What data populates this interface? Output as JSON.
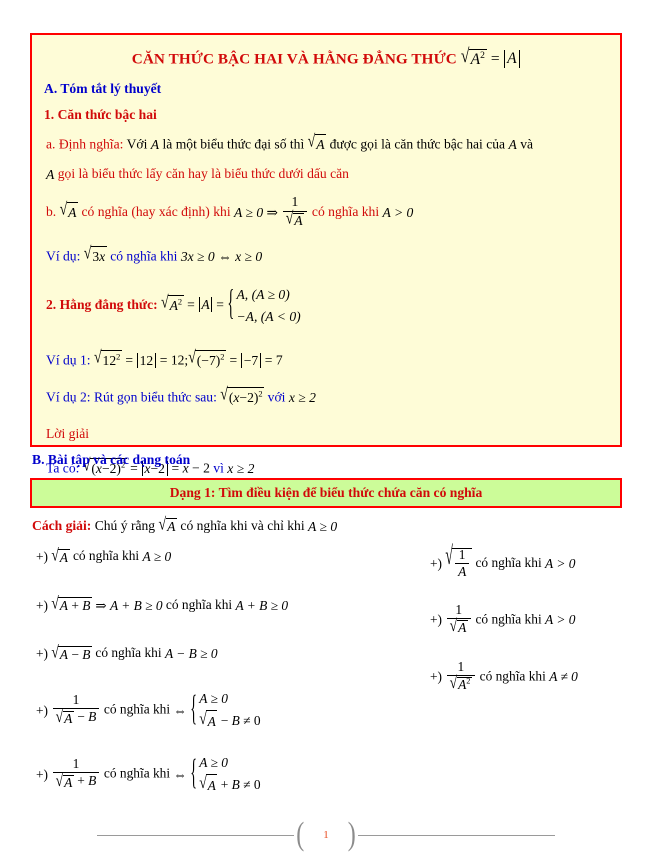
{
  "document": {
    "title_text": "CĂN THỨC BẬC HAI VÀ HẰNG ĐẲNG THỨC",
    "section_a": "A. Tóm tắt lý thuyết",
    "sub_1": "1. Căn thức bậc hai",
    "def_a_label": "a. Định nghĩa:",
    "def_a_text_1": "Với",
    "def_a_text_2": "là một biểu thức đại số thì",
    "def_a_text_3": "được gọi là căn thức bậc hai của",
    "def_a_text_4": "và",
    "def_a_text_5": "gọi là biểu thức lấy căn hay là biểu thức dưới dấu căn",
    "def_b_label": "b.",
    "def_b_text_1": "có nghĩa (hay xác định) khi",
    "def_b_text_2": "có nghĩa khi",
    "example_label": "Ví dụ:",
    "example_text": "có nghĩa khi",
    "sub_2": "2. Hằng đẳng thức:",
    "vd1_label": "Ví dụ 1:",
    "vd2_label": "Ví dụ 2:",
    "vd2_text": "Rút gọn biểu thức sau:",
    "vd2_with": "với",
    "loi_giai": "Lời giải",
    "ta_co": "Ta có:",
    "vi": "vì",
    "section_b": "B. Bài tập và các dạng toán",
    "dang_1": "Dạng 1: Tìm điều kiện để biểu thức chứa căn có nghĩa",
    "cach_giai_label": "Cách giải:",
    "cach_giai_text_1": "Chú ý rằng",
    "cach_giai_text_2": "có nghĩa khi và chỉ khi"
  },
  "math": {
    "A": "A",
    "B": "B",
    "sqrt_A_sq_eq_abs_A": "√A² = |A|",
    "A_ge_0": "A ≥ 0",
    "A_gt_0": "A > 0",
    "A_lt_0": "A < 0",
    "A_ne_0": "A ≠ 0",
    "three_x_ge_0": "3x ≥ 0",
    "x_ge_0": "x ≥ 0",
    "x_ge_2": "x ≥ 2",
    "iff": "⇔",
    "implies": "⇒",
    "case_pos": "A, (A ≥ 0)",
    "case_neg": "−A, (A < 0)",
    "vd1_expr": "√12² = |12| = 12; √(−7)² = |−7| = 7",
    "vd2_expr": "√(x−2)²",
    "ta_co_expr": "√(x−2)² = |x−2| = x − 2",
    "A_plus_B": "A + B",
    "A_minus_B": "A − B",
    "A_plus_B_ge_0": "A + B ≥ 0",
    "A_minus_B_ge_0": "A − B ≥ 0",
    "sqrt_A_minus_B_ne_0": "√A − B ≠ 0",
    "sqrt_A_plus_B_ne_0": "√A + B ≠ 0",
    "one": "1",
    "co_nghia_khi": "có nghĩa khi",
    "plus_marker": "+)"
  },
  "footer": {
    "page_number": "1",
    "left_paren": "(",
    "right_paren": ")"
  },
  "colors": {
    "red": "#d10a0a",
    "blue": "#0000cc",
    "box_bg": "#fefcd7",
    "box_border": "#ff0000",
    "banner_bg": "#ccfc99",
    "page_number": "#e8491d"
  }
}
